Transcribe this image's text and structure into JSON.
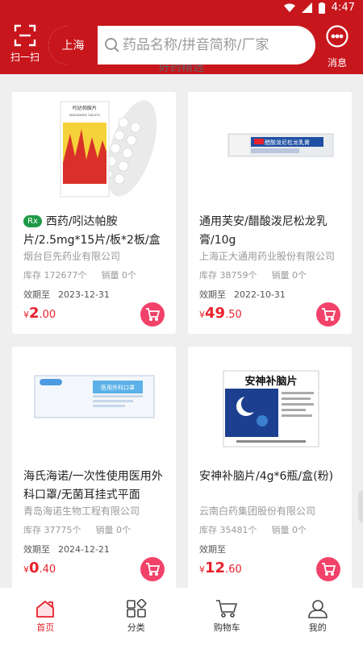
{
  "status_bar": {
    "time": "4:47"
  },
  "header": {
    "scan_label": "扫一扫",
    "city": "上海",
    "search_placeholder": "药品名称/拼音简称/厂家",
    "message_label": "消息"
  },
  "section_title": "好药精选",
  "products": [
    {
      "rx_badge": "Rx",
      "name": "西药/吲达帕胺片/2.5mg*15片/板*2板/盒",
      "manufacturer": "烟台巨先药业有限公司",
      "stock": "库存  172677个",
      "sales": "销量  0个",
      "expiry_label": "效期至",
      "expiry_date": "2023-12-31",
      "price_currency": "¥",
      "price_int": "2",
      "price_dec": ".00"
    },
    {
      "rx_badge": "",
      "name": "通用芙安/醋酸泼尼松龙乳膏/10g",
      "manufacturer": "上海正大通用药业股份有限公司",
      "stock": "库存  38759个",
      "sales": "销量  0个",
      "expiry_label": "效期至",
      "expiry_date": "2022-10-31",
      "price_currency": "¥",
      "price_int": "49",
      "price_dec": ".50"
    },
    {
      "rx_badge": "",
      "name": "海氏海诺/一次性使用医用外科口罩/无菌耳挂式平面",
      "manufacturer": "青岛海诺生物工程有限公司",
      "stock": "库存  37775个",
      "sales": "销量  0个",
      "expiry_label": "效期至",
      "expiry_date": "2024-12-21",
      "price_currency": "¥",
      "price_int": "0",
      "price_dec": ".40"
    },
    {
      "rx_badge": "",
      "name": "安神补脑片/4g*6瓶/盒(粉)",
      "manufacturer": "云南白药集团股份有限公司",
      "stock": "库存  35481个",
      "sales": "销量  0个",
      "expiry_label": "效期至",
      "expiry_date": "",
      "price_currency": "¥",
      "price_int": "12",
      "price_dec": ".60"
    }
  ],
  "product_images": {
    "p1_box": "吲达帕胺片",
    "p1_box_en": "INDAPAMIDE TABLETS",
    "p2_box": "醋酸泼尼松龙乳膏",
    "p3_box": "医用外科口罩",
    "p4_box": "安神补脑片"
  },
  "tabs": [
    {
      "label": "首页",
      "icon": "home-icon",
      "active": true
    },
    {
      "label": "分类",
      "icon": "category-icon",
      "active": false
    },
    {
      "label": "购物车",
      "icon": "cart-icon",
      "active": false
    },
    {
      "label": "我的",
      "icon": "user-icon",
      "active": false
    }
  ],
  "colors": {
    "brand_red": "#c8161d",
    "price_red": "#e8212c",
    "cart_pink": "#f2426a",
    "rx_green": "#1e9a46"
  }
}
